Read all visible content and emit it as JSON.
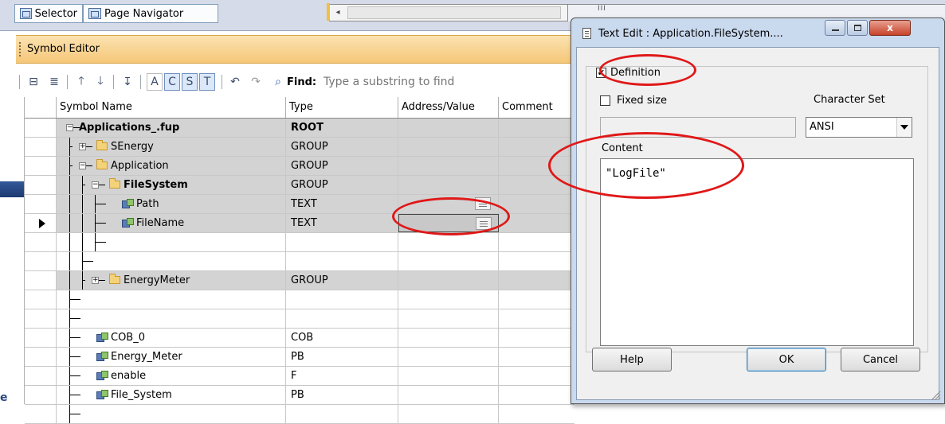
{
  "tabs": [
    {
      "label": "Selector"
    },
    {
      "label": "Page Navigator"
    }
  ],
  "scrollbar": {
    "left_arrow": "◂",
    "grip": "III"
  },
  "symbol_editor": {
    "title": "Symbol Editor"
  },
  "toolbar": {
    "buttons": [
      "A",
      "C",
      "S",
      "T"
    ],
    "find_label": "Find:",
    "find_placeholder": "Type a substring to find"
  },
  "grid": {
    "columns": [
      "Symbol Name",
      "Type",
      "Address/Value",
      "Comment"
    ],
    "rows": [
      {
        "name": "Applications_.fup",
        "type": "ROOT",
        "bold": true
      },
      {
        "name": "SEnergy",
        "type": "GROUP"
      },
      {
        "name": "Application",
        "type": "GROUP"
      },
      {
        "name": "FileSystem",
        "type": "GROUP",
        "bold": true
      },
      {
        "name": "Path",
        "type": "TEXT"
      },
      {
        "name": "FileName",
        "type": "TEXT",
        "selected": true
      },
      {
        "name": "",
        "type": ""
      },
      {
        "name": "",
        "type": ""
      },
      {
        "name": "EnergyMeter",
        "type": "GROUP"
      },
      {
        "name": "",
        "type": ""
      },
      {
        "name": "",
        "type": ""
      },
      {
        "name": "COB_0",
        "type": "COB"
      },
      {
        "name": "Energy_Meter",
        "type": "PB"
      },
      {
        "name": "enable",
        "type": "F"
      },
      {
        "name": "File_System",
        "type": "PB"
      },
      {
        "name": "",
        "type": ""
      }
    ]
  },
  "dialog": {
    "title": "Text Edit : Application.FileSystem....",
    "close_label": "x",
    "definition_label": "Definition",
    "definition_checked": "✔",
    "fixed_size_label": "Fixed size",
    "character_set_label": "Character Set",
    "character_set_value": "ANSI",
    "content_label": "Content",
    "content_value": "\"LogFile\"",
    "help_label": "Help",
    "ok_label": "OK",
    "cancel_label": "Cancel"
  },
  "bottom_fragment": "e",
  "colors": {
    "highlight_circle": "#e01818",
    "arrow": "#1e3f7a",
    "header_orange": "#f5c779",
    "dialog_frame": "#c9d9ee"
  }
}
